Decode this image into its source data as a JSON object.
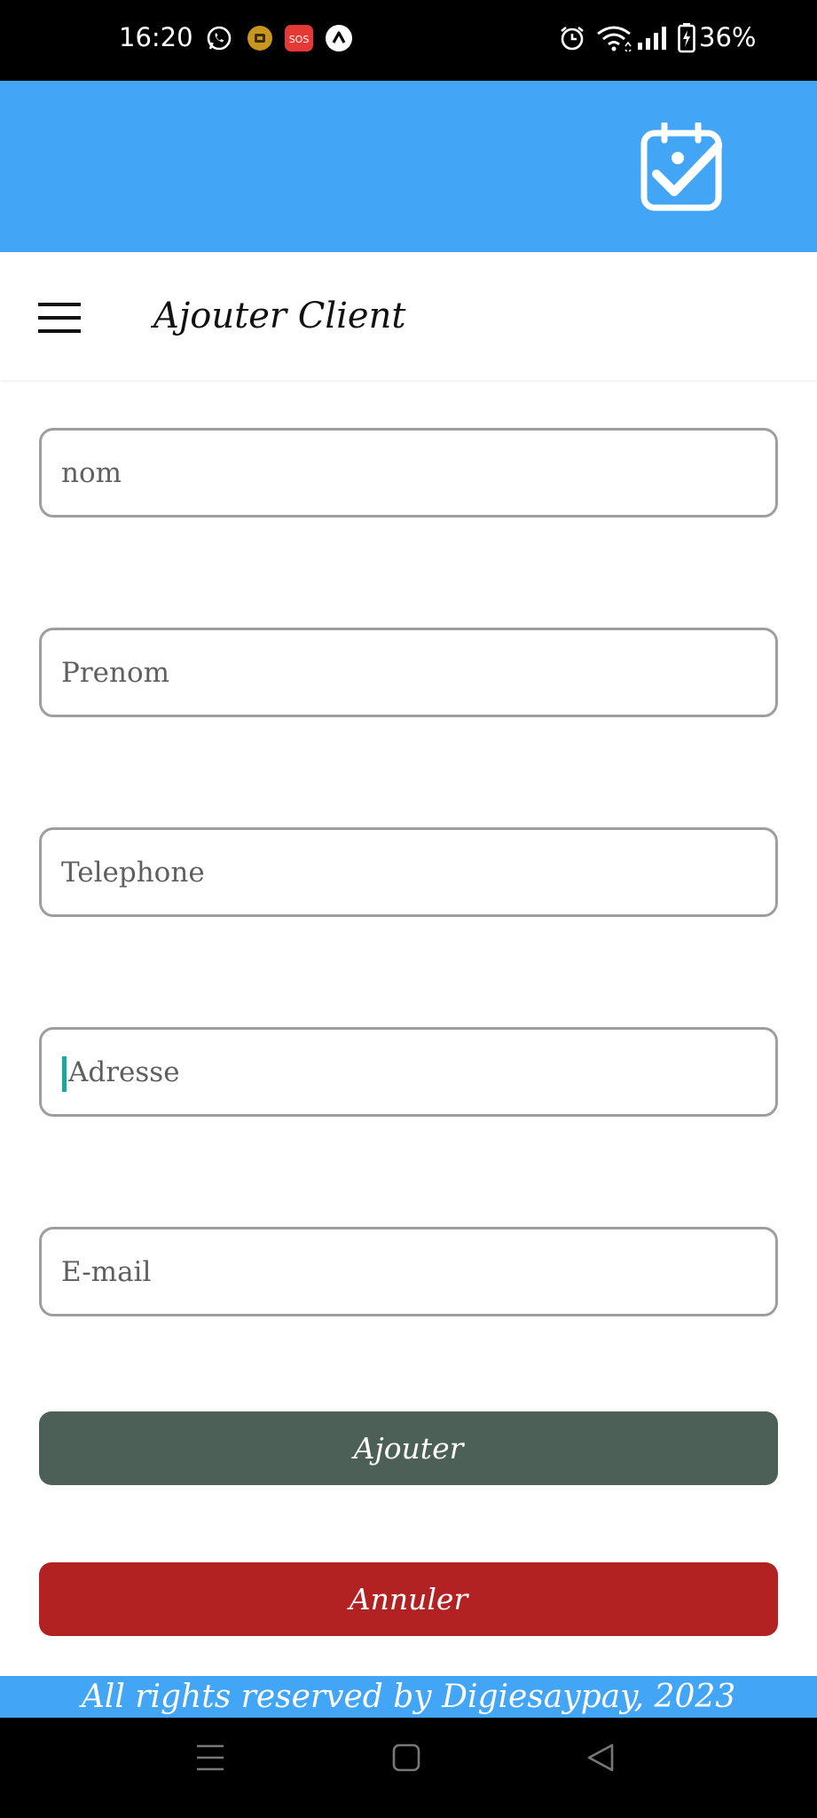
{
  "status_bar": {
    "time": "16:20",
    "battery": "36%",
    "icons": [
      "whatsapp-icon",
      "app-notification-icon",
      "sos-icon",
      "app-a-icon",
      "alarm-icon",
      "wifi-icon",
      "signal-icon",
      "battery-icon"
    ],
    "sos_label": "SOS"
  },
  "header": {
    "icon": "calendar-check-icon",
    "color": "#42a5f5"
  },
  "toolbar": {
    "title": "Ajouter Client",
    "menu_icon": "hamburger-menu-icon"
  },
  "form": {
    "fields": [
      {
        "placeholder": "nom",
        "value": ""
      },
      {
        "placeholder": "Prenom",
        "value": ""
      },
      {
        "placeholder": "Telephone",
        "value": ""
      },
      {
        "placeholder": "Adresse",
        "value": ""
      },
      {
        "placeholder": "E-mail",
        "value": ""
      }
    ],
    "focused_field": "Adresse"
  },
  "buttons": {
    "add_label": "Ajouter",
    "cancel_label": "Annuler",
    "add_color": "#4d6058",
    "cancel_color": "#b22222"
  },
  "footer": {
    "text": "All rights reserved by Digiesaypay, 2023"
  },
  "nav_bar": {
    "icons": [
      "recents-icon",
      "home-icon",
      "back-icon"
    ]
  }
}
